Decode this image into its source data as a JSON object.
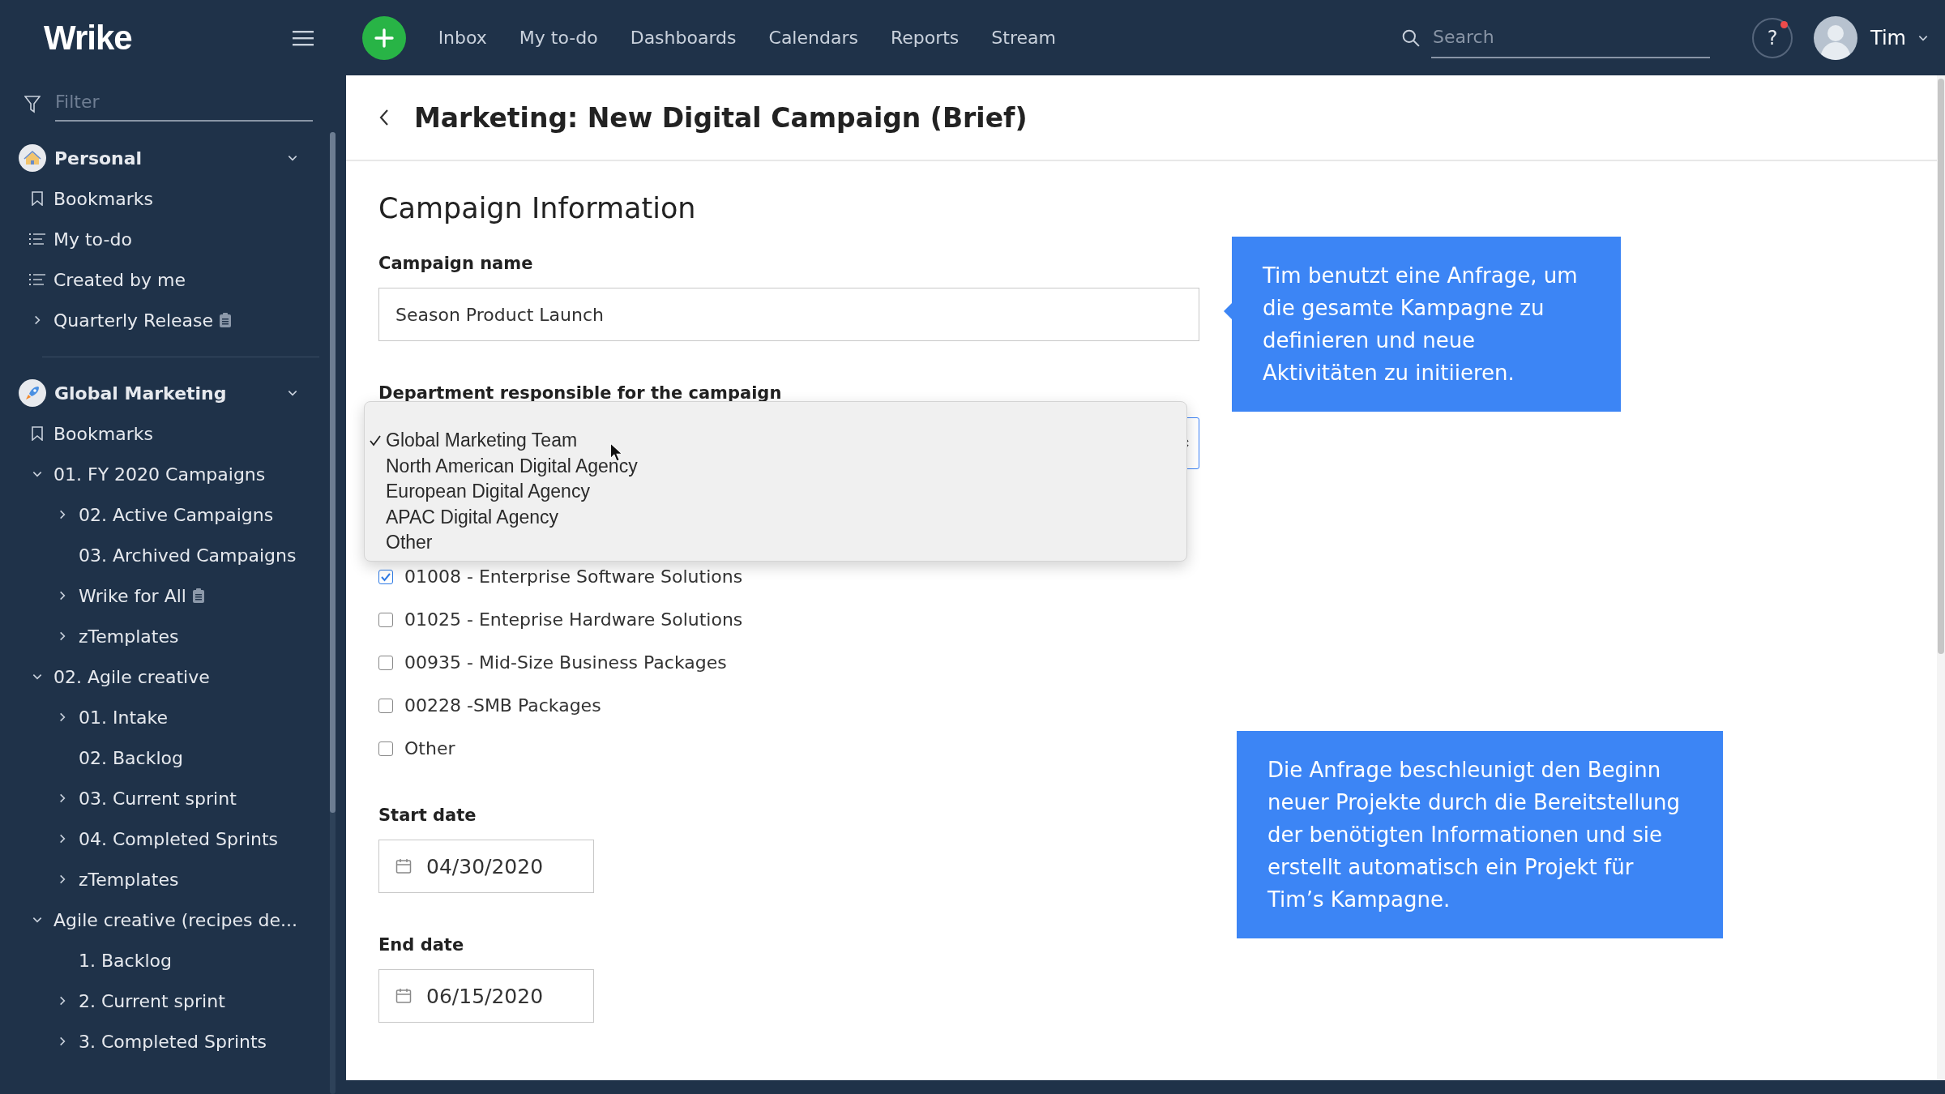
{
  "topbar": {
    "logo": "Wrike",
    "nav": [
      "Inbox",
      "My to-do",
      "Dashboards",
      "Calendars",
      "Reports",
      "Stream"
    ],
    "search": {
      "placeholder": "Search"
    },
    "help": "?",
    "notification": true,
    "user": "Tim"
  },
  "sidebar": {
    "filter": {
      "placeholder": "Filter"
    },
    "sections": [
      {
        "title": "Personal",
        "expanded": true,
        "items": [
          {
            "label": "Bookmarks",
            "kind": "bookmark"
          },
          {
            "label": "My to-do",
            "kind": "list"
          },
          {
            "label": "Created by me",
            "kind": "list"
          },
          {
            "label": "Quarterly Release",
            "kind": "project",
            "expanded": false
          }
        ]
      },
      {
        "title": "Global Marketing",
        "expanded": true,
        "items": [
          {
            "label": "Bookmarks",
            "kind": "bookmark"
          },
          {
            "label": "01. FY 2020 Campaigns",
            "kind": "folder",
            "expanded": true,
            "children": [
              {
                "label": "02. Active Campaigns",
                "kind": "folder",
                "expanded": false
              },
              {
                "label": "03. Archived Campaigns",
                "kind": "leaf"
              },
              {
                "label": "Wrike for All",
                "kind": "project",
                "expanded": false
              },
              {
                "label": "zTemplates",
                "kind": "folder",
                "expanded": false
              }
            ]
          },
          {
            "label": "02. Agile creative",
            "kind": "folder",
            "expanded": true,
            "children": [
              {
                "label": "01. Intake",
                "kind": "folder",
                "expanded": false
              },
              {
                "label": "02. Backlog",
                "kind": "leaf"
              },
              {
                "label": "03. Current sprint",
                "kind": "folder",
                "expanded": false
              },
              {
                "label": "04. Completed Sprints",
                "kind": "folder",
                "expanded": false
              },
              {
                "label": "zTemplates",
                "kind": "folder",
                "expanded": false
              }
            ]
          },
          {
            "label": "Agile creative (recipes de...",
            "kind": "folder",
            "expanded": true,
            "children": [
              {
                "label": "1. Backlog",
                "kind": "leaf"
              },
              {
                "label": "2. Current sprint",
                "kind": "folder",
                "expanded": false
              },
              {
                "label": "3. Completed Sprints",
                "kind": "folder",
                "expanded": false
              }
            ]
          }
        ]
      }
    ]
  },
  "page": {
    "title": "Marketing: New Digital Campaign (Brief)",
    "form": {
      "heading": "Campaign Information",
      "campaign_name": {
        "label": "Campaign name",
        "value": "Season Product Launch"
      },
      "department": {
        "label": "Department responsible for the campaign",
        "open": true,
        "options": [
          {
            "label": "Global Marketing Team",
            "selected": true
          },
          {
            "label": "North American Digital Agency",
            "selected": false
          },
          {
            "label": "European Digital Agency",
            "selected": false
          },
          {
            "label": "APAC Digital Agency",
            "selected": false
          },
          {
            "label": "Other",
            "selected": false
          }
        ]
      },
      "products": [
        {
          "label": "01008 - Enterprise Software Solutions",
          "checked": true
        },
        {
          "label": "01025 - Enteprise Hardware Solutions",
          "checked": false
        },
        {
          "label": "00935 - Mid-Size Business Packages",
          "checked": false
        },
        {
          "label": "00228 -SMB Packages",
          "checked": false
        },
        {
          "label": "Other",
          "checked": false
        }
      ],
      "start_date": {
        "label": "Start date",
        "value": "04/30/2020"
      },
      "end_date": {
        "label": "End date",
        "value": "06/15/2020"
      }
    }
  },
  "callouts": [
    "Tim benutzt eine Anfrage, um die gesamte Kampagne zu definieren und neue Aktivitäten zu initiieren.",
    "Die Anfrage beschleunigt den Beginn neuer Projekte durch die Bereitstellung der benötigten Informationen und sie erstellt automatisch ein Projekt für Tim’s Kampagne."
  ]
}
